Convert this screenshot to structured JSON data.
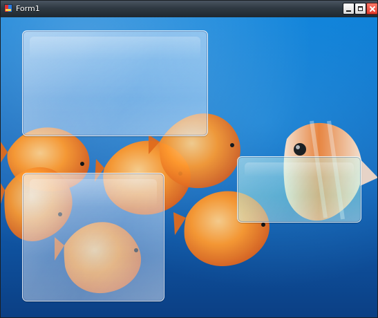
{
  "window": {
    "title": "Form1",
    "icon": "app-icon",
    "controls": {
      "minimize": "minimize-icon",
      "maximize": "maximize-icon",
      "close": "close-icon"
    }
  },
  "colors": {
    "background_blue": "#1262b6",
    "fish_orange": "#f28a22",
    "glass_white": "#ffffff",
    "glass_teal": "#78e6d2",
    "close_red": "#e23b2c"
  }
}
